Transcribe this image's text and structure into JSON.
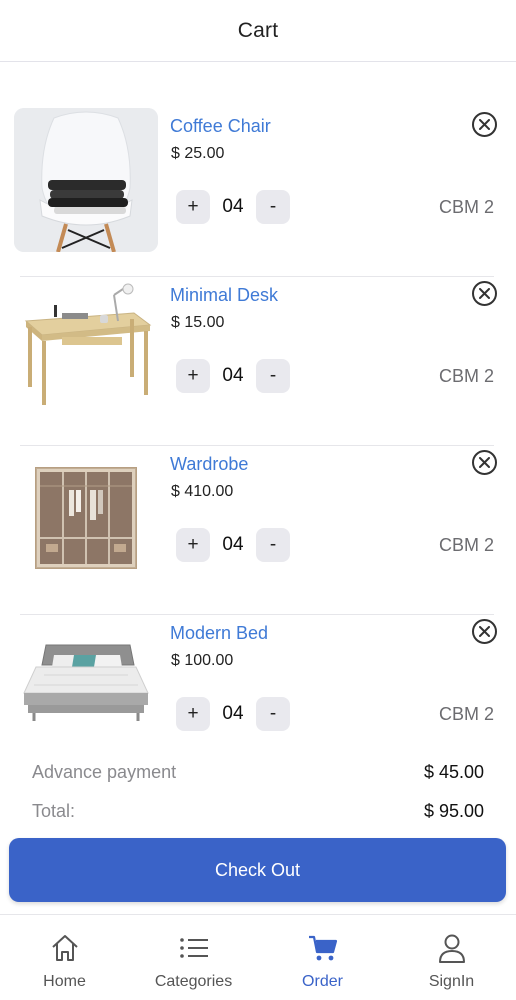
{
  "header": {
    "title": "Cart"
  },
  "items": [
    {
      "name": "Coffee Chair",
      "price": "$ 25.00",
      "qty": "04",
      "plus": "+",
      "minus": "-",
      "cbm": "CBM 2",
      "image": "chair"
    },
    {
      "name": "Minimal Desk",
      "price": "$ 15.00",
      "qty": "04",
      "plus": "+",
      "minus": "-",
      "cbm": "CBM 2",
      "image": "desk"
    },
    {
      "name": "Wardrobe",
      "price": "$ 410.00",
      "qty": "04",
      "plus": "+",
      "minus": "-",
      "cbm": "CBM 2",
      "image": "wardrobe"
    },
    {
      "name": "Modern Bed",
      "price": "$ 100.00",
      "qty": "04",
      "plus": "+",
      "minus": "-",
      "cbm": "CBM 2",
      "image": "bed"
    }
  ],
  "summary": {
    "advance_label": "Advance payment",
    "advance_value": "$ 45.00",
    "total_label": "Total:",
    "total_value": "$ 95.00"
  },
  "checkout": {
    "label": "Check Out"
  },
  "tabs": [
    {
      "label": "Home",
      "icon": "home-icon",
      "active": false
    },
    {
      "label": "Categories",
      "icon": "list-icon",
      "active": false
    },
    {
      "label": "Order",
      "icon": "cart-icon",
      "active": true
    },
    {
      "label": "SignIn",
      "icon": "user-icon",
      "active": false
    }
  ],
  "colors": {
    "accent": "#3a63c8",
    "link": "#3f7ad6",
    "muted": "#8a8a8e"
  }
}
